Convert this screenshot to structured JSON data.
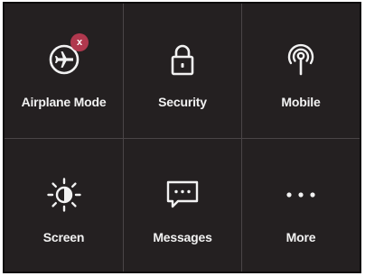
{
  "tiles": [
    {
      "label": "Airplane Mode",
      "icon": "airplane-icon",
      "badge": "x"
    },
    {
      "label": "Security",
      "icon": "lock-icon"
    },
    {
      "label": "Mobile",
      "icon": "antenna-icon"
    },
    {
      "label": "Screen",
      "icon": "brightness-icon"
    },
    {
      "label": "Messages",
      "icon": "message-icon"
    },
    {
      "label": "More",
      "icon": "more-icon"
    }
  ],
  "colors": {
    "background": "#242021",
    "divider": "#4a4547",
    "text": "#f2f2f2",
    "badge": "#b0384e"
  }
}
